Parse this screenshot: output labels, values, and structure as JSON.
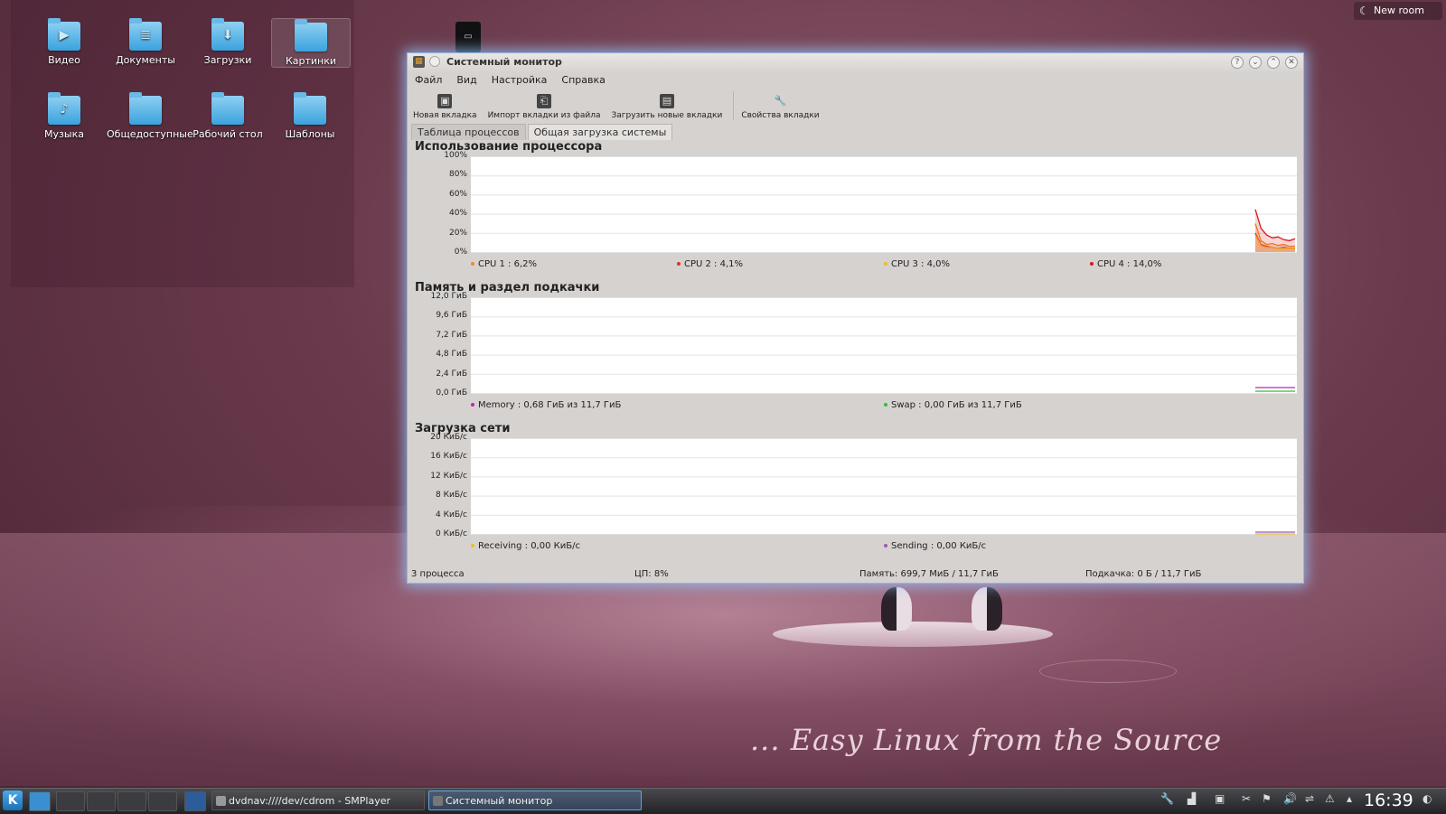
{
  "desktop": {
    "icons": [
      {
        "label": "Видео",
        "glyph": "▶"
      },
      {
        "label": "Документы",
        "glyph": "≣"
      },
      {
        "label": "Загрузки",
        "glyph": "⬇"
      },
      {
        "label": "Картинки",
        "glyph": ""
      },
      {
        "label": "Музыка",
        "glyph": "♪"
      },
      {
        "label": "Общедоступные",
        "glyph": ""
      },
      {
        "label": "Рабочий стол",
        "glyph": ""
      },
      {
        "label": "Шаблоны",
        "glyph": ""
      }
    ],
    "top_right_label": "New room",
    "slogan": "... Easy Linux from the Source"
  },
  "window": {
    "title": "Системный монитор",
    "menu": [
      "Файл",
      "Вид",
      "Настройка",
      "Справка"
    ],
    "toolbar": [
      "Новая вкладка",
      "Импорт вкладки из файла",
      "Загрузить новые вкладки",
      "Свойства вкладки"
    ],
    "tabs": [
      "Таблица процессов",
      "Общая загрузка системы"
    ],
    "active_tab": 1,
    "sections": {
      "cpu": {
        "title": "Использование процессора",
        "yticks": [
          "100%",
          "80%",
          "60%",
          "40%",
          "20%",
          "0%"
        ],
        "legend": [
          "CPU 1 : 6,2%",
          "CPU 2 : 4,1%",
          "CPU 3 : 4,0%",
          "CPU 4 : 14,0%"
        ]
      },
      "mem": {
        "title": "Память и раздел подкачки",
        "yticks": [
          "12,0 ГиБ",
          "9,6 ГиБ",
          "7,2 ГиБ",
          "4,8 ГиБ",
          "2,4 ГиБ",
          "0,0 ГиБ"
        ],
        "legend": [
          "Memory : 0,68 ГиБ из 11,7 ГиБ",
          "Swap : 0,00 ГиБ из 11,7 ГиБ"
        ]
      },
      "net": {
        "title": "Загрузка сети",
        "yticks": [
          "20 КиБ/с",
          "16 КиБ/с",
          "12 КиБ/с",
          "8 КиБ/с",
          "4 КиБ/с",
          "0 КиБ/с"
        ],
        "legend": [
          "Receiving : 0,00 КиБ/с",
          "Sending : 0,00 КиБ/с"
        ]
      }
    },
    "status": [
      "3 процесса",
      "ЦП: 8%",
      "Память: 699,7 МиБ / 11,7 ГиБ",
      "Подкачка: 0 Б / 11,7 ГиБ"
    ]
  },
  "colors": {
    "cpu1": "#f08a24",
    "cpu2": "#e03030",
    "cpu3": "#e8c020",
    "cpu4": "#d81818",
    "memory": "#c020c0",
    "swap": "#30c030",
    "receiving": "#e8c020",
    "sending": "#9b59b6",
    "window_glow": "#8fb6e6"
  },
  "chart_data": [
    {
      "type": "area",
      "title": "Использование процессора",
      "ylim": [
        0,
        100
      ],
      "series": [
        {
          "name": "CPU 1",
          "values": [
            30,
            12,
            8,
            9,
            7,
            8,
            6,
            6.2
          ]
        },
        {
          "name": "CPU 2",
          "values": [
            20,
            8,
            6,
            5,
            4,
            5,
            4,
            4.1
          ]
        },
        {
          "name": "CPU 3",
          "values": [
            18,
            7,
            5,
            5,
            4,
            4,
            4,
            4.0
          ]
        },
        {
          "name": "CPU 4",
          "values": [
            45,
            25,
            18,
            15,
            16,
            13,
            12,
            14.0
          ]
        }
      ]
    },
    {
      "type": "line",
      "title": "Память и раздел подкачки",
      "ylim": [
        0,
        12
      ],
      "series": [
        {
          "name": "Memory",
          "values": [
            0.68,
            0.68,
            0.68,
            0.68
          ]
        },
        {
          "name": "Swap",
          "values": [
            0.0,
            0.0,
            0.0,
            0.0
          ]
        }
      ]
    },
    {
      "type": "line",
      "title": "Загрузка сети",
      "ylim": [
        0,
        20
      ],
      "series": [
        {
          "name": "Receiving",
          "values": [
            0,
            0,
            0,
            0
          ]
        },
        {
          "name": "Sending",
          "values": [
            0,
            0,
            0,
            0
          ]
        }
      ]
    }
  ],
  "taskbar": {
    "tasks": [
      "dvdnav:////dev/cdrom - SMPlayer",
      "Системный монитор"
    ],
    "clock": "16:39",
    "start_label": "K"
  }
}
